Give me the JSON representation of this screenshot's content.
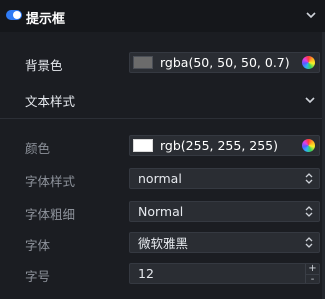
{
  "header": {
    "title": "提示框",
    "toggle_on": true,
    "accent": "#2f7bf5"
  },
  "rows": {
    "background": {
      "label": "背景色",
      "value": "rgba(50, 50, 50, 0.7)",
      "swatch_color": "#6b6b6b"
    },
    "text_style": {
      "label": "文本样式"
    },
    "color": {
      "label": "颜色",
      "value": "rgb(255, 255, 255)",
      "swatch_color": "#ffffff"
    },
    "font_style": {
      "label": "字体样式",
      "value": "normal"
    },
    "font_weight": {
      "label": "字体粗细",
      "value": "Normal"
    },
    "font_family": {
      "label": "字体",
      "value": "微软雅黑"
    },
    "font_size": {
      "label": "字号",
      "value": "12",
      "increment": "+",
      "decrement": "-"
    }
  },
  "icons": {
    "header_chevron": "chevron-down-icon",
    "section_chevron": "chevron-down-icon",
    "color_picker": "color-wheel-icon",
    "select_arrows": "updown-arrows-icon"
  }
}
